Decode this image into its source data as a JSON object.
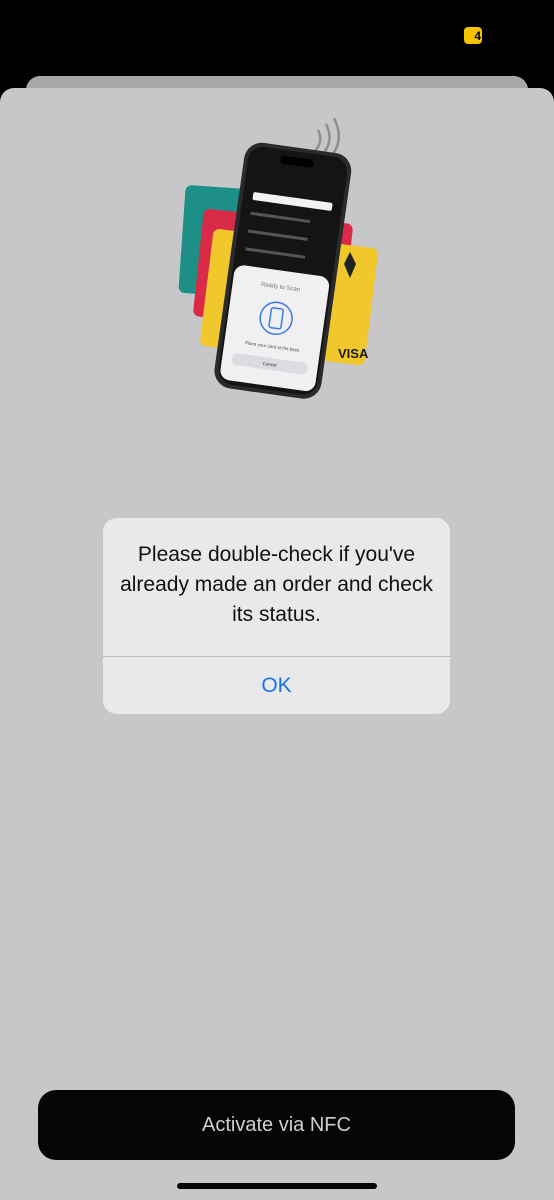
{
  "status_bar": {
    "battery_level": "4",
    "battery_color": "#f5c400"
  },
  "illustration": {
    "phone_screen_title": "Ready to Scan",
    "phone_screen_caption": "Place your card at the back",
    "phone_screen_cancel": "Cancel",
    "card_brand": "VISA",
    "card_colors": [
      "#1e8f86",
      "#d92b48",
      "#f0c82c"
    ],
    "icons": [
      "nfc-waves-icon",
      "scan-phone-icon"
    ]
  },
  "alert": {
    "message": "Please double-check if you've already made an order and check its status.",
    "ok_label": "OK"
  },
  "footer": {
    "activate_button_label": "Activate via NFC"
  },
  "colors": {
    "sheet_background": "#c7c7ca",
    "alert_background": "#e9e9eb",
    "link_blue": "#1a73e8",
    "button_dark": "#060606"
  }
}
